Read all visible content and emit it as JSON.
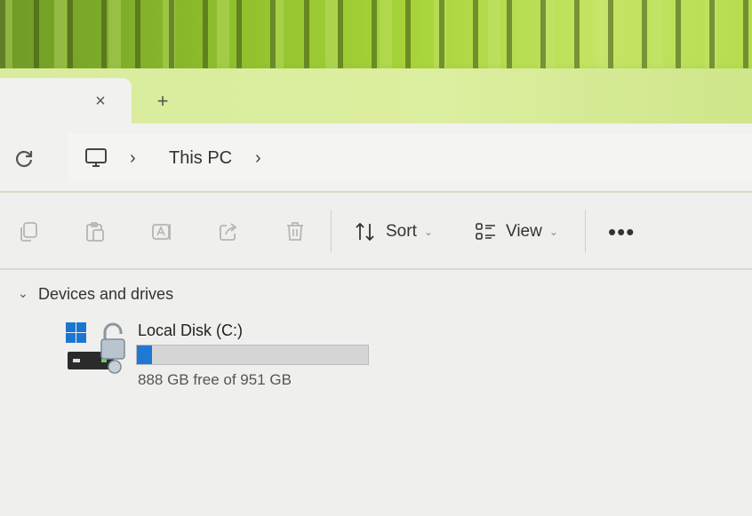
{
  "tabs": {
    "close_symbol": "×",
    "new_tab_symbol": "+"
  },
  "breadcrumb": {
    "separator": "›",
    "location": "This PC"
  },
  "toolbar": {
    "copy_icon": "copy-icon",
    "paste_icon": "paste-icon",
    "rename_icon": "rename-icon",
    "share_icon": "share-icon",
    "delete_icon": "delete-icon",
    "sort_label": "Sort",
    "view_label": "View",
    "dropdown_chevron": "⌄",
    "more_label": "•••"
  },
  "section": {
    "chevron": "⌄",
    "title": "Devices and drives"
  },
  "drive": {
    "name": "Local Disk (C:)",
    "space_text": "888 GB free of 951 GB",
    "used_fraction": 0.066,
    "bar_color": "#1f78d1"
  },
  "colors": {
    "accent": "#1f78d1",
    "windows_logo": "#1b76d2"
  }
}
